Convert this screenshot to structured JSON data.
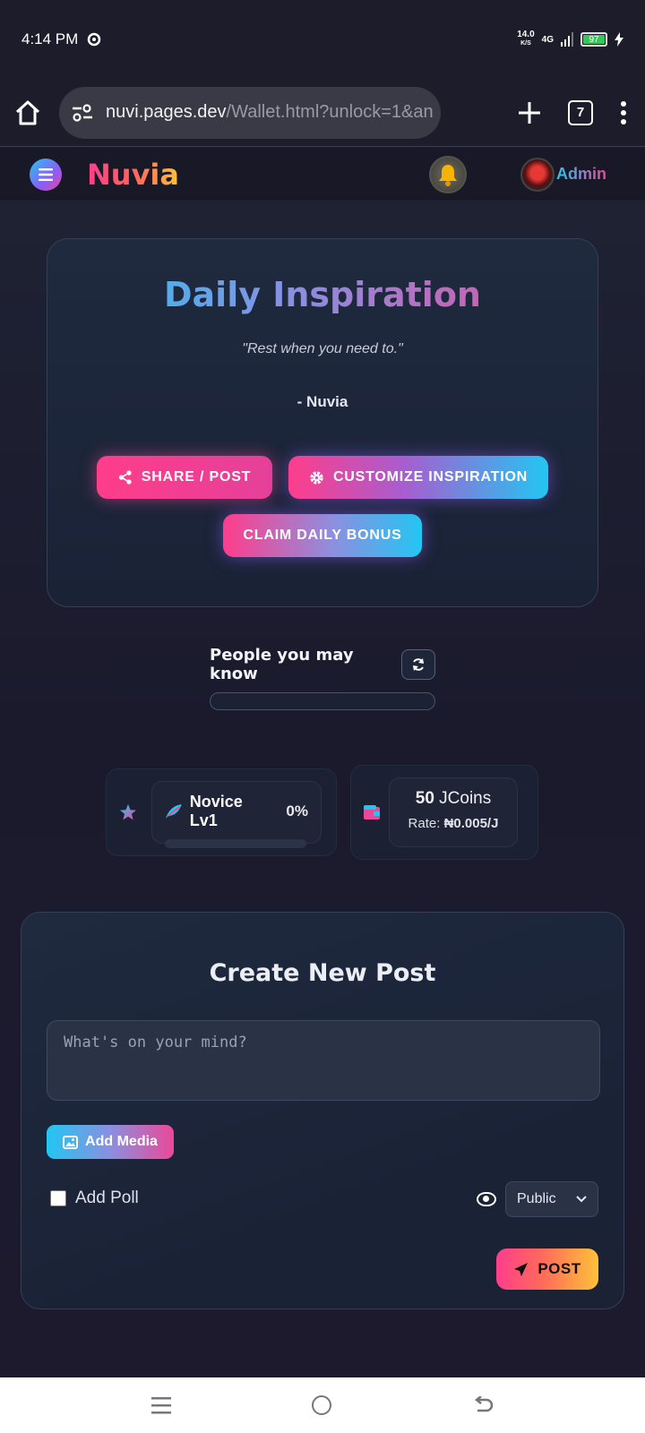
{
  "status_bar": {
    "time": "4:14 PM",
    "net_speed_value": "14.0",
    "net_speed_unit": "K/S",
    "network": "4G",
    "battery": "97"
  },
  "browser": {
    "url_host": "nuvi.pages.dev",
    "url_path": "/Wallet.html?unlock=1&an",
    "tab_count": "7"
  },
  "header": {
    "brand": "Nuvia",
    "user_label": "Admin"
  },
  "inspiration": {
    "title": "Daily Inspiration",
    "quote": "\"Rest when you need to.\"",
    "author": "- Nuvia",
    "share_label": "Share / Post",
    "customize_label": "Customize Inspiration",
    "bonus_label": "Claim Daily Bonus"
  },
  "people": {
    "heading": "People you may know"
  },
  "level": {
    "label": "Novice Lv1",
    "percent": "0%",
    "progress": 0
  },
  "coins": {
    "amount": "50",
    "unit": "JCoins",
    "rate_label": "Rate:",
    "rate_value": "₦0.005/J"
  },
  "create_post": {
    "title": "Create New Post",
    "placeholder": "What's on your mind?",
    "add_media_label": "Add Media",
    "add_poll_label": "Add Poll",
    "visibility": "Public",
    "post_label": "POST"
  }
}
